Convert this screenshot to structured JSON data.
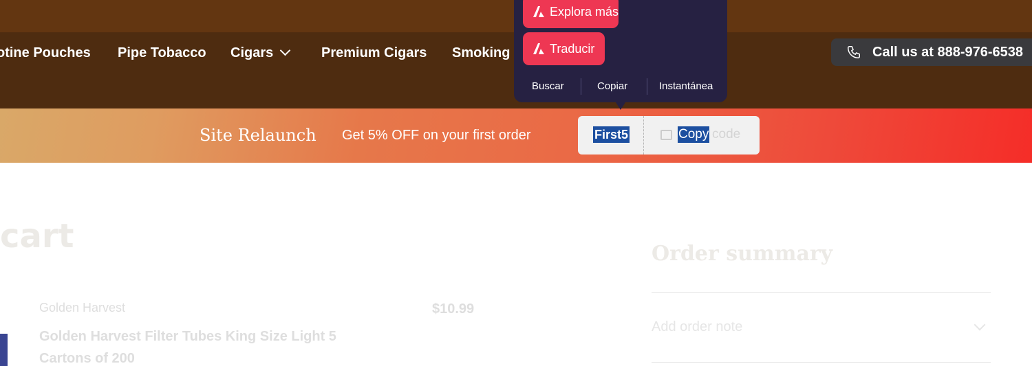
{
  "nav": {
    "items": [
      "otine Pouches",
      "Pipe Tobacco",
      "Cigars",
      "Premium Cigars",
      "Smoking"
    ],
    "call_label": "Call us at 888-976-6538"
  },
  "promo": {
    "title": "Site Relaunch",
    "text": "Get 5% OFF on your first order",
    "code": "First5",
    "copy_selected": "Copy",
    "copy_rest": " code"
  },
  "popup": {
    "explore_label": "Explora más",
    "translate_label": "Traducir",
    "links": [
      "Buscar",
      "Copiar",
      "Instantánea"
    ]
  },
  "cart": {
    "title": "cart",
    "item": {
      "vendor": "Golden Harvest",
      "title": "Golden Harvest Filter Tubes King Size Light 5 Cartons of 200",
      "price": "$10.99"
    }
  },
  "summary": {
    "title": "Order summary",
    "order_note_label": "Add order note"
  },
  "colors": {
    "header_top": "#633611",
    "header_nav": "#4e2c10",
    "popup_bg": "#262142",
    "popup_button": "#ee3753",
    "selection": "#1c4fa0"
  },
  "icons": [
    "phone-icon",
    "chevron-down-icon",
    "ai-logo-icon",
    "copy-icon"
  ]
}
